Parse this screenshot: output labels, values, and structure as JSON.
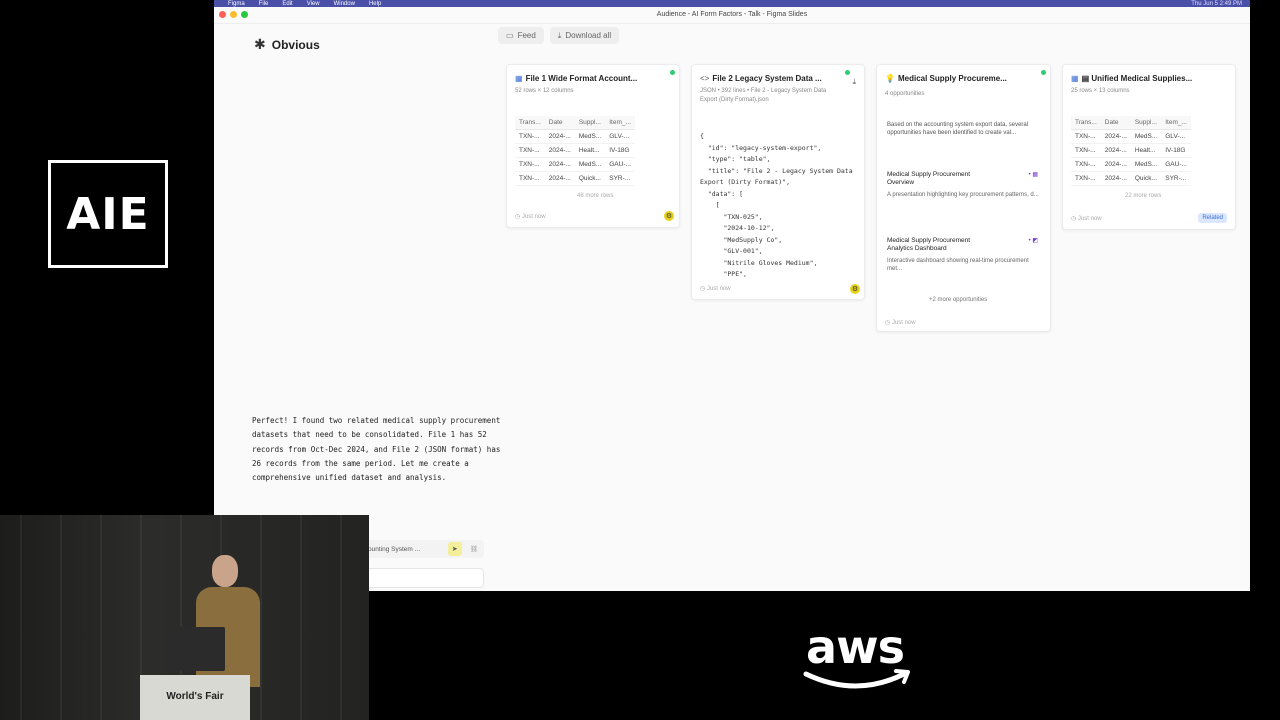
{
  "menubar": {
    "app": "Figma",
    "items": [
      "File",
      "Edit",
      "View",
      "Window",
      "Help"
    ],
    "clock": "Thu Jun 5 2:49 PM"
  },
  "window": {
    "title": "Audience - AI Form Factors - Talk - Figma Slides"
  },
  "brand": {
    "name": "Obvious",
    "icon": "gear-icon"
  },
  "toolbar": {
    "feed_label": "Feed",
    "download_label": "Download all"
  },
  "cards": {
    "file1": {
      "icon": "table-icon",
      "title": "File 1 Wide Format Account...",
      "subtitle": "52 rows × 12 columns",
      "columns": [
        "Trans...",
        "Date",
        "Suppl...",
        "Item_..."
      ],
      "rows": [
        [
          "TXN-...",
          "2024-...",
          "MedS...",
          "GLV-..."
        ],
        [
          "TXN-...",
          "2024-...",
          "Healt...",
          "IV-18G"
        ],
        [
          "TXN-...",
          "2024-...",
          "MedS...",
          "GAU-..."
        ],
        [
          "TXN-...",
          "2024-...",
          "Quick...",
          "SYR-..."
        ]
      ],
      "more": "48 more rows",
      "timestamp": "Just now"
    },
    "file2": {
      "icon": "code-icon",
      "title": "File 2 Legacy System Data ...",
      "subtitle": "JSON • 392 lines • File 2 - Legacy System Data Export (Dirty Format).json",
      "code": "{\n  \"id\": \"legacy-system-export\",\n  \"type\": \"table\",\n  \"title\": \"File 2 - Legacy System Data Export (Dirty Format)\",\n  \"data\": [\n    [\n      \"TXN-025\",\n      \"2024-10-12\",\n      \"MedSupply Co\",\n      \"GLV-001\",\n      \"Nitrile Gloves Medium\",\n      \"PPE\",",
      "timestamp": "Just now"
    },
    "opportunities": {
      "icon": "bulb-icon",
      "title": "Medical Supply Procureme...",
      "subtitle": "4 opportunities",
      "intro": "Based on the accounting system export data, several opportunities have been identified to create val...",
      "items": [
        {
          "title": "Medical Supply Procurement Overview",
          "desc": "A presentation highlighting key procurement patterns, d...",
          "tag": "• ▦"
        },
        {
          "title": "Medical Supply Procurement Analytics Dashboard",
          "desc": "Interactive dashboard showing real-time procurement met...",
          "tag": "• ◩"
        }
      ],
      "more": "+2 more opportunities",
      "timestamp": "Just now"
    },
    "unified": {
      "icon": "table-icon",
      "title": "▤ Unified Medical Supplies...",
      "subtitle": "25 rows × 13 columns",
      "columns": [
        "Trans...",
        "Date",
        "Suppl...",
        "Item_..."
      ],
      "rows": [
        [
          "TXN-...",
          "2024-...",
          "MedS...",
          "GLV-..."
        ],
        [
          "TXN-...",
          "2024-...",
          "Healt...",
          "IV-18G"
        ],
        [
          "TXN-...",
          "2024-...",
          "MedS...",
          "GAU-..."
        ],
        [
          "TXN-...",
          "2024-...",
          "Quick...",
          "SYR-..."
        ]
      ],
      "more": "22 more rows",
      "timestamp": "Just now",
      "badge": "Related"
    }
  },
  "chat": {
    "message": "Perfect! I found two related medical supply procurement datasets that need to be consolidated. File 1 has 52 records from Oct-Dec 2024, and File 2 (JSON format) has 26 records from the same period. Let me create a comprehensive unified dataset and analysis.",
    "chip_label": "ounting System ..."
  },
  "overlay": {
    "conference_logo": "AIE",
    "podium_text": "World's Fair",
    "sponsor": "aws"
  },
  "colors": {
    "accent": "#3b6fd4",
    "status_green": "#2ecc71",
    "highlight_yellow": "#e6d21a",
    "menubar": "#4a4fa8"
  }
}
